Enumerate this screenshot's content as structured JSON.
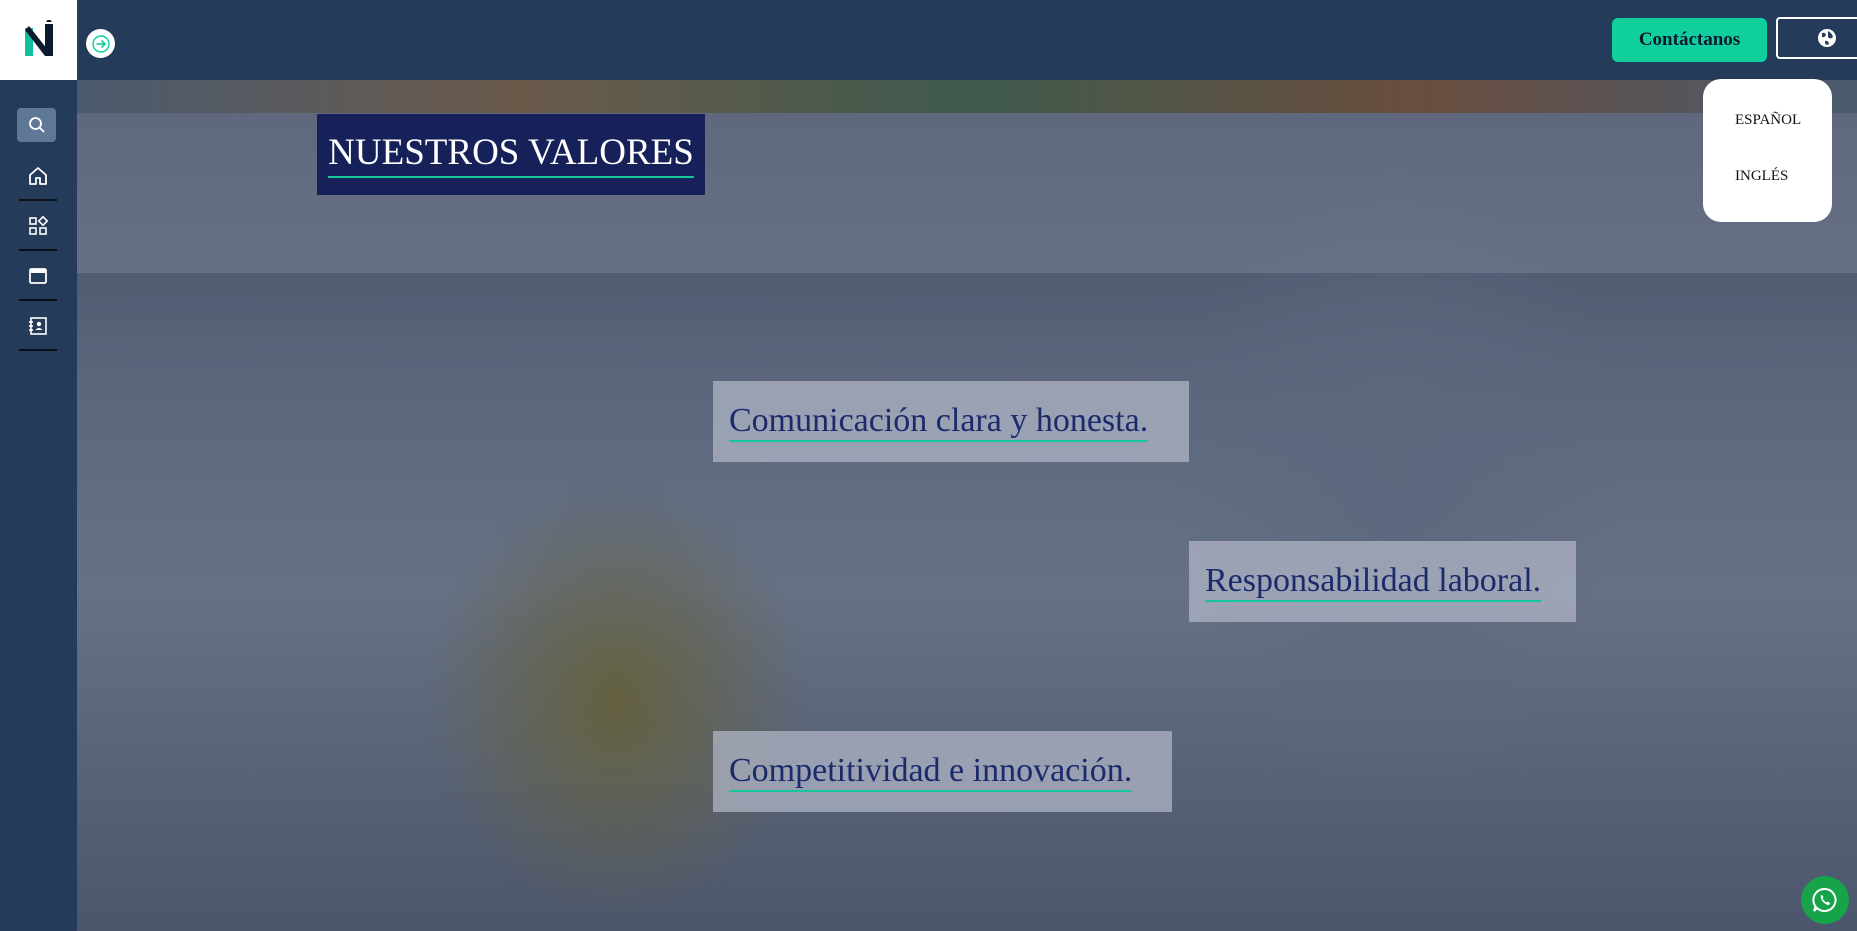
{
  "header": {
    "contact_label": "Contáctanos"
  },
  "language_menu": {
    "items": [
      "ESPAÑOL",
      "INGLÉS"
    ]
  },
  "hero": {
    "title": "NUESTROS VALORES",
    "values": [
      "Comunicación clara y honesta.",
      "Responsabilidad laboral.",
      "Competitividad e innovación."
    ]
  },
  "icons": {
    "logo": "n-logo-icon",
    "menu_toggle": "arrow-right-icon",
    "search": "search-icon",
    "nav": [
      "home-icon",
      "grid-icon",
      "window-icon",
      "contact-book-icon"
    ],
    "language": "globe-icon",
    "chat": "whatsapp-icon"
  },
  "colors": {
    "navy": "#253b5a",
    "accent": "#0fcf9d",
    "title_bg": "#16215a",
    "value_text": "#1b2a6b",
    "whatsapp": "#16a34a"
  }
}
